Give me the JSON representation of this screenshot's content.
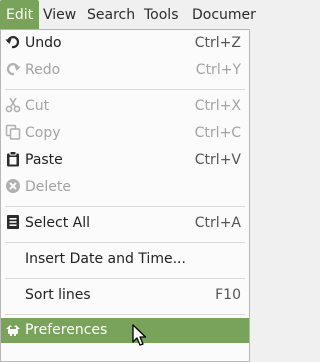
{
  "menubar": {
    "items": [
      "Edit",
      "View",
      "Search",
      "Tools",
      "Documer"
    ]
  },
  "edit_menu": {
    "items": [
      {
        "label": "Undo",
        "accel": "Ctrl+Z",
        "icon": "undo-icon",
        "enabled": true
      },
      {
        "label": "Redo",
        "accel": "Ctrl+Y",
        "icon": "redo-icon",
        "enabled": false
      },
      {
        "label": "Cut",
        "accel": "Ctrl+X",
        "icon": "scissors-icon",
        "enabled": false
      },
      {
        "label": "Copy",
        "accel": "Ctrl+C",
        "icon": "copy-icon",
        "enabled": false
      },
      {
        "label": "Paste",
        "accel": "Ctrl+V",
        "icon": "clipboard-icon",
        "enabled": true
      },
      {
        "label": "Delete",
        "accel": "",
        "icon": "delete-icon",
        "enabled": false
      },
      {
        "label": "Select All",
        "accel": "Ctrl+A",
        "icon": "select-all-icon",
        "enabled": true
      },
      {
        "label": "Insert Date and Time...",
        "accel": "",
        "icon": "",
        "enabled": true
      },
      {
        "label": "Sort lines",
        "accel": "F10",
        "icon": "",
        "enabled": true
      },
      {
        "label": "Preferences",
        "accel": "",
        "icon": "preferences-icon",
        "enabled": true,
        "highlighted": true
      }
    ]
  },
  "colors": {
    "accent": "#79a35a",
    "disabled_text": "#a3a3a3",
    "menu_background": "#fbfbfb"
  }
}
